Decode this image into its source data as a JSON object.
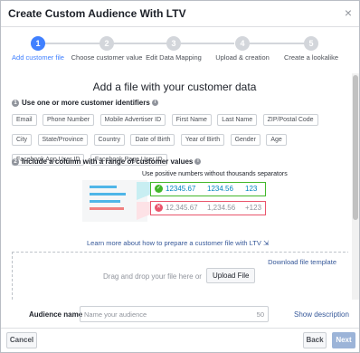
{
  "dialog": {
    "title": "Create Custom Audience With LTV",
    "close_icon": "×"
  },
  "steps": [
    {
      "num": "1",
      "label": "Add customer file",
      "active": true
    },
    {
      "num": "2",
      "label": "Choose customer value",
      "active": false
    },
    {
      "num": "3",
      "label": "Edit Data Mapping",
      "active": false
    },
    {
      "num": "4",
      "label": "Upload & creation",
      "active": false
    },
    {
      "num": "5",
      "label": "Create a lookalike",
      "active": false
    }
  ],
  "main": {
    "heading": "Add a file with your customer data",
    "section1": {
      "num": "1",
      "title": "Use one or more customer identifiers",
      "info_icon": "i"
    },
    "identifiers": [
      "Email",
      "Phone Number",
      "Mobile Advertiser ID",
      "First Name",
      "Last Name",
      "ZIP/Postal Code",
      "City",
      "State/Province",
      "Country",
      "Date of Birth",
      "Year of Birth",
      "Gender",
      "Age",
      "Facebook App User ID",
      "Facebook Page User ID"
    ],
    "section2": {
      "num": "2",
      "title": "Include a column with a range of customer values",
      "info_icon": "i"
    },
    "hint": "Use positive numbers without thousands separators",
    "good_values": [
      "12345.67",
      "1234.56",
      "123"
    ],
    "bad_values": [
      "12,345.67",
      "1,234.56",
      "+123"
    ],
    "learn_more": "Learn more about how to prepare a customer file with LTV",
    "download_template": "Download file template",
    "drop_text": "Drag and drop your file here or",
    "upload_button": "Upload File"
  },
  "audience": {
    "label": "Audience name",
    "placeholder": "Name your audience",
    "counter": "50",
    "show_description": "Show description"
  },
  "footer": {
    "cancel": "Cancel",
    "back": "Back",
    "next": "Next"
  },
  "colors": {
    "accent": "#4080ff",
    "good": "#42b72a",
    "bad": "#e9546b",
    "link": "#365899"
  }
}
